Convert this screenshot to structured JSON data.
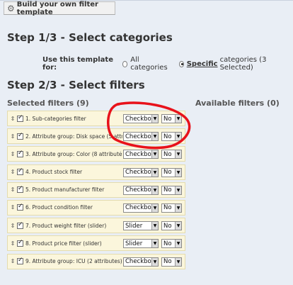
{
  "legend": {
    "title": "Build your own filter template",
    "icon": "gear-icon"
  },
  "step1": {
    "title": "Step 1/3 - Select categories",
    "use_label": "Use this template for:",
    "options": [
      {
        "label": "All categories",
        "selected": false
      },
      {
        "label_bold": "Specific",
        "label_rest": "categories (3 Selected)",
        "selected": true
      }
    ]
  },
  "step2": {
    "title": "Step 2/3 - Select filters",
    "selected_header": "Selected filters (9)",
    "available_header": "Available filters (0)"
  },
  "filters": [
    {
      "name": "1. Sub-categories filter",
      "type": "Checkbox",
      "yn": "No"
    },
    {
      "name": "2. Attribute group: Disk space (5 attributes)",
      "type": "Checkbox",
      "yn": "No"
    },
    {
      "name": "3. Attribute group: Color (8 attributes))",
      "type": "Checkbox",
      "yn": "No"
    },
    {
      "name": "4. Product stock filter",
      "type": "Checkbox",
      "yn": "No"
    },
    {
      "name": "5. Product manufacturer filter",
      "type": "Checkbox",
      "yn": "No"
    },
    {
      "name": "6. Product condition filter",
      "type": "Checkbox",
      "yn": "No"
    },
    {
      "name": "7. Product weight filter (slider)",
      "type": "Slider",
      "yn": "No"
    },
    {
      "name": "8. Product price filter (slider)",
      "type": "Slider",
      "yn": "No"
    },
    {
      "name": "9. Attribute group: ICU (2 attributes))",
      "type": "Checkbox",
      "yn": "No"
    }
  ],
  "colors": {
    "annotation": "#e8121b",
    "row_bg": "#fbf6dc",
    "panel_bg": "#e9eef5"
  }
}
